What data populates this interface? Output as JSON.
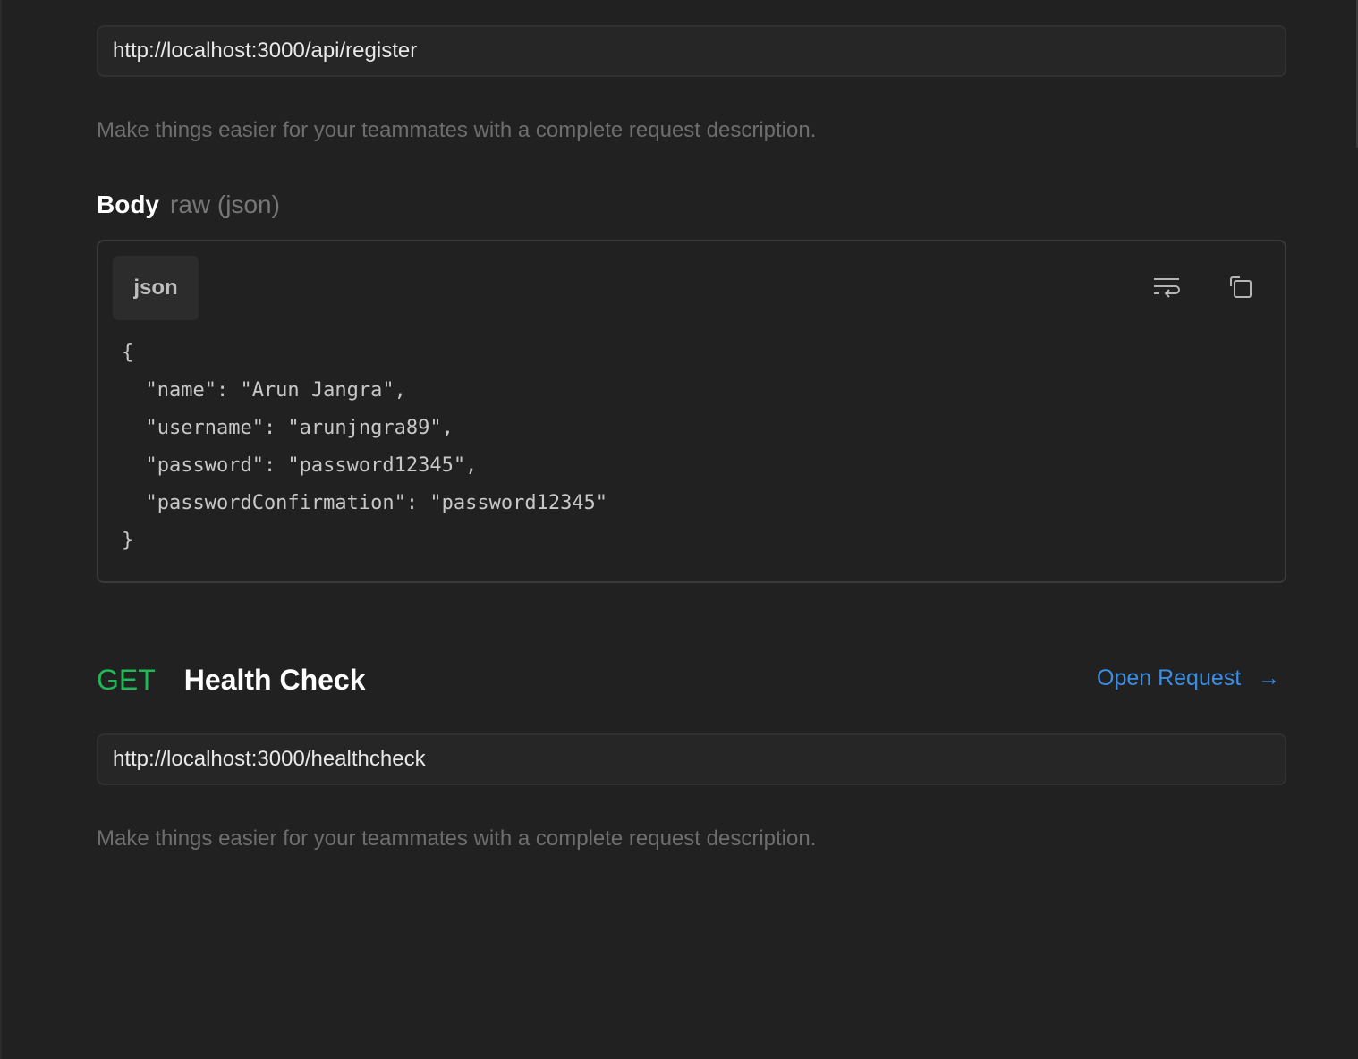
{
  "request1": {
    "url": "http://localhost:3000/api/register",
    "description_placeholder": "Make things easier for your teammates with a complete request description.",
    "body_label": "Body",
    "body_type": "raw (json)",
    "code_language": "json",
    "code": "{\n  \"name\": \"Arun Jangra\",\n  \"username\": \"arunjngra89\",\n  \"password\": \"password12345\",\n  \"passwordConfirmation\": \"password12345\"\n}",
    "icons": [
      "wrap-text-icon",
      "copy-icon"
    ]
  },
  "request2": {
    "method": "GET",
    "name": "Health Check",
    "open_label": "Open Request",
    "url": "http://localhost:3000/healthcheck",
    "description_placeholder": "Make things easier for your teammates with a complete request description."
  },
  "colors": {
    "method_get": "#1db954",
    "link": "#3a8ee6",
    "background": "#212121"
  }
}
